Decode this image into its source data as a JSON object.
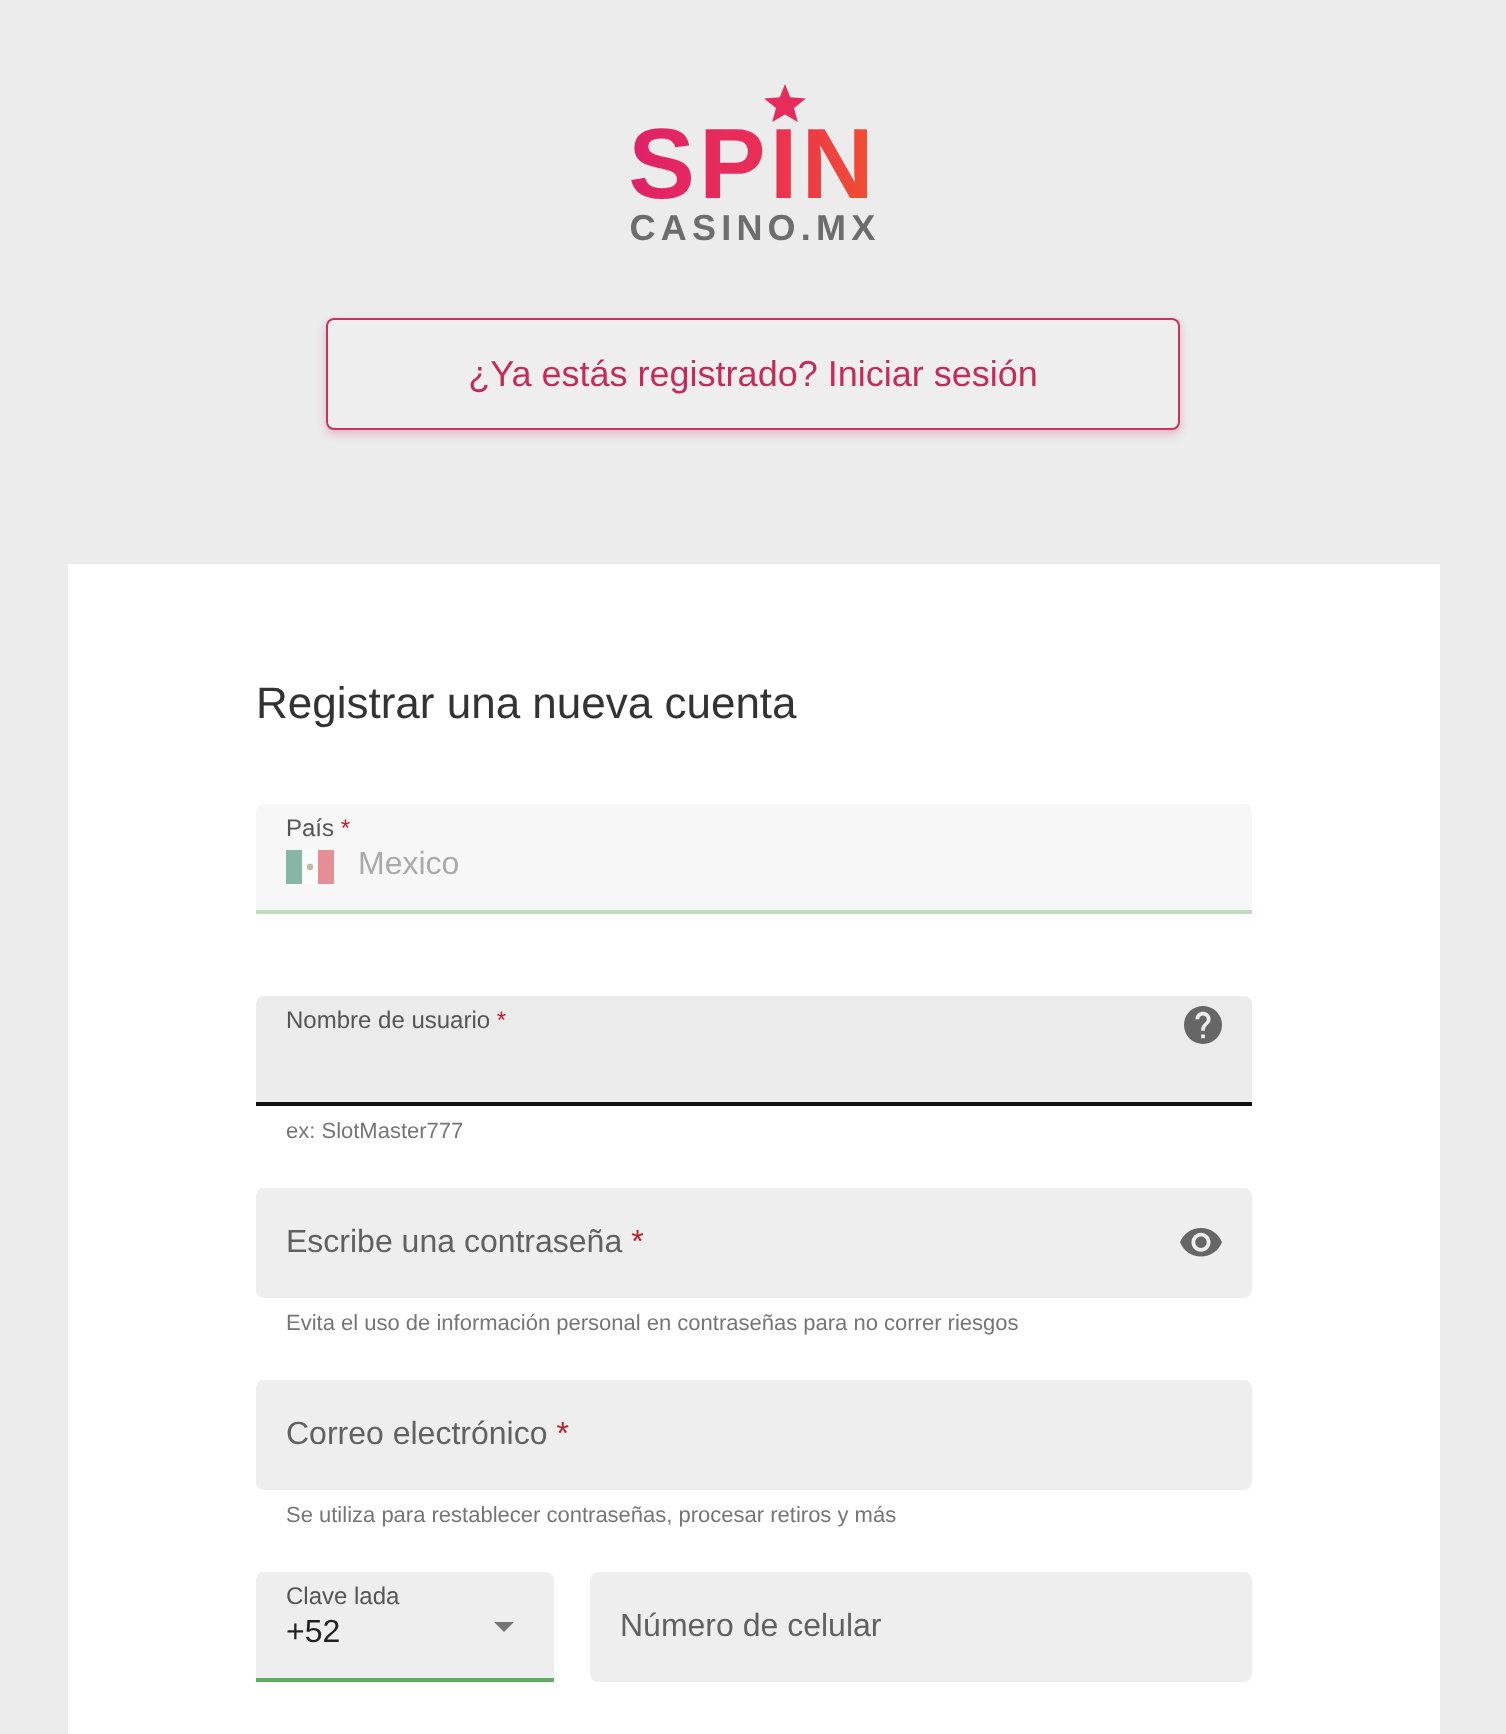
{
  "logo": {
    "wordmark": "SPIN",
    "subtitle": "CASINO.MX"
  },
  "login_link": {
    "label": "¿Ya estás registrado? Iniciar sesión"
  },
  "form": {
    "title": "Registrar una nueva cuenta",
    "fields": [
      {
        "kind": "country",
        "label": "País",
        "required_mark": "*",
        "value": "Mexico",
        "valid": true,
        "focused": false,
        "disabled": true
      },
      {
        "kind": "username",
        "label": "Nombre de usuario",
        "required_mark": "*",
        "valid": false,
        "focused": true,
        "disabled": false,
        "hint": "ex: SlotMaster777"
      },
      {
        "kind": "password",
        "label": "Escribe una contraseña",
        "required_mark": "*",
        "valid": false,
        "focused": false,
        "disabled": false,
        "hint": "Evita el uso de información personal en contraseñas para no correr riesgos"
      },
      {
        "kind": "email",
        "label": "Correo electrónico",
        "required_mark": "*",
        "valid": false,
        "focused": false,
        "disabled": false,
        "hint": "Se utiliza para restablecer contraseñas, procesar retiros y más"
      }
    ],
    "phone": [
      {
        "kind": "select",
        "label": "Clave lada",
        "value": "+52",
        "valid": true,
        "focused": false,
        "disabled": false
      },
      {
        "kind": "tel",
        "label": "Número de celular",
        "valid": false,
        "focused": false,
        "disabled": false
      }
    ]
  }
}
